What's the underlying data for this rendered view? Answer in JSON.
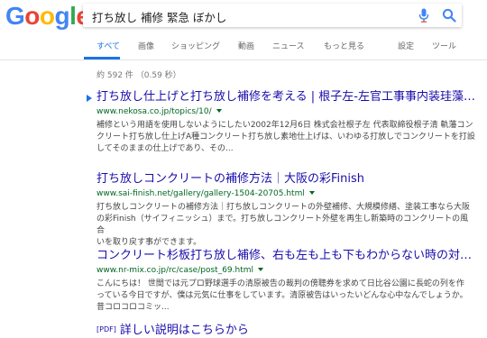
{
  "logo": {
    "letters": [
      "G",
      "o",
      "o",
      "g",
      "l",
      "e"
    ],
    "colors": [
      "#4285F4",
      "#EA4335",
      "#FBBC05",
      "#4285F4",
      "#34A853",
      "#EA4335"
    ]
  },
  "search": {
    "query": "打ち放し 補修 緊急 ぼかし",
    "mic_icon": "mic-icon",
    "search_icon": "search-icon"
  },
  "tabs": {
    "all": "すべて",
    "images": "画像",
    "shopping": "ショッピング",
    "videos": "動画",
    "news": "ニュース",
    "more": "もっと見る",
    "settings": "設定",
    "tools": "ツール"
  },
  "stats": "約 592 件 （0.59 秒）",
  "results": [
    {
      "title": "打ち放し仕上げと打ち放し補修を考える | 根子左-左官工事事内装珪藻土...",
      "url": "www.nekosa.co.jp/topics/10/",
      "snippet_1": "補修という用語を使用しないようにしたい2002年12月6日 株式会社根子左 代表取締役根子清 軌藩コン",
      "snippet_2": "クリート打ち放し仕上げA種コンクリート打ち放し素地仕上げは、いわゆる打放しでコンクリートを打設",
      "snippet_3": "してそのままの仕上げであり、その..."
    },
    {
      "title": "打ち放しコンクリートの補修方法｜大阪の彩Finish",
      "url": "www.sai-finish.net/gallery/gallery-1504-20705.html",
      "snippet_1": "打ち放しコンクリートの補修方法｜打ち放しコンクリートの外壁補修、大規模修繕、塗装工事なら大阪",
      "snippet_2": "の彩Finish（サイフィニッシュ）まで。打ち放しコンクリート外壁を再生し新築時のコンクリートの風合",
      "snippet_3": "いを取り戻す事ができます。"
    },
    {
      "title": "コンクリート杉板打ち放し補修、右も左も上も下もわからない時の対処...",
      "url": "www.nr-mix.co.jp/rc/case/post_69.html",
      "snippet_1": "こんにちは！ 世間では元プロ野球選手の清原被告の裁判の傍聴券を求めて日比谷公園に長蛇の列を作",
      "snippet_2": "っている今日ですが、僕は元気に仕事をしています。清原被告はいったいどんな心中なんでしょうか。",
      "snippet_3": "昔コロコロコミッ..."
    },
    {
      "pdf_tag": "[PDF]",
      "title": "詳しい説明はこちらから"
    }
  ]
}
